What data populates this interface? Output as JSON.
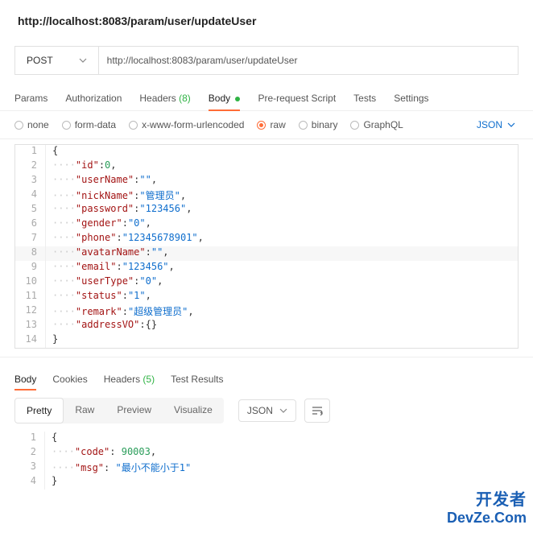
{
  "header_url": "http://localhost:8083/param/user/updateUser",
  "method": "POST",
  "url_value": "http://localhost:8083/param/user/updateUser",
  "tabs": {
    "params": "Params",
    "authorization": "Authorization",
    "headers_label": "Headers",
    "headers_count": "(8)",
    "body": "Body",
    "prerequest": "Pre-request Script",
    "tests": "Tests",
    "settings": "Settings"
  },
  "body_types": {
    "none": "none",
    "formdata": "form-data",
    "xwww": "x-www-form-urlencoded",
    "raw": "raw",
    "binary": "binary",
    "graphql": "GraphQL"
  },
  "content_type": "JSON",
  "request_body": {
    "id": 0,
    "userName": "",
    "nickName": "管理员",
    "password": "123456",
    "gender": "0",
    "phone": "12345678901",
    "avatarName": "",
    "email": "123456",
    "userType": "0",
    "status": "1",
    "remark": "超级管理员",
    "addressVO": {}
  },
  "request_lines": [
    {
      "n": 1,
      "indent": 0,
      "brace": "{"
    },
    {
      "n": 2,
      "indent": 1,
      "key": "id",
      "raw_val": "0",
      "type": "num",
      "comma": true
    },
    {
      "n": 3,
      "indent": 1,
      "key": "userName",
      "val": "",
      "comma": true
    },
    {
      "n": 4,
      "indent": 1,
      "key": "nickName",
      "val": "管理员",
      "comma": true
    },
    {
      "n": 5,
      "indent": 1,
      "key": "password",
      "val": "123456",
      "comma": true
    },
    {
      "n": 6,
      "indent": 1,
      "key": "gender",
      "val": "0",
      "comma": true
    },
    {
      "n": 7,
      "indent": 1,
      "key": "phone",
      "val": "12345678901",
      "comma": true
    },
    {
      "n": 8,
      "indent": 1,
      "key": "avatarName",
      "val": "",
      "comma": true,
      "hl": true
    },
    {
      "n": 9,
      "indent": 1,
      "key": "email",
      "val": "123456",
      "comma": true
    },
    {
      "n": 10,
      "indent": 1,
      "key": "userType",
      "val": "0",
      "comma": true
    },
    {
      "n": 11,
      "indent": 1,
      "key": "status",
      "val": "1",
      "comma": true
    },
    {
      "n": 12,
      "indent": 1,
      "key": "remark",
      "val": "超级管理员",
      "comma": true
    },
    {
      "n": 13,
      "indent": 1,
      "key": "addressVO",
      "raw_val": "{}",
      "type": "punc"
    },
    {
      "n": 14,
      "indent": 0,
      "brace": "}"
    }
  ],
  "resp_tabs": {
    "body": "Body",
    "cookies": "Cookies",
    "headers_label": "Headers",
    "headers_count": "(5)",
    "tests": "Test Results"
  },
  "view_modes": {
    "pretty": "Pretty",
    "raw": "Raw",
    "preview": "Preview",
    "visualize": "Visualize"
  },
  "resp_format": "JSON",
  "response_body": {
    "code": 90003,
    "msg": "最小不能小于1"
  },
  "response_lines": [
    {
      "n": 1,
      "indent": 0,
      "brace": "{"
    },
    {
      "n": 2,
      "indent": 1,
      "key": "code",
      "raw_val": "90003",
      "type": "num",
      "comma": true,
      "sp": true
    },
    {
      "n": 3,
      "indent": 1,
      "key": "msg",
      "val": "最小不能小于1",
      "sp": true
    },
    {
      "n": 4,
      "indent": 0,
      "brace": "}"
    }
  ],
  "watermark": {
    "line1": "开发者",
    "line2": "DevZe.Com"
  }
}
